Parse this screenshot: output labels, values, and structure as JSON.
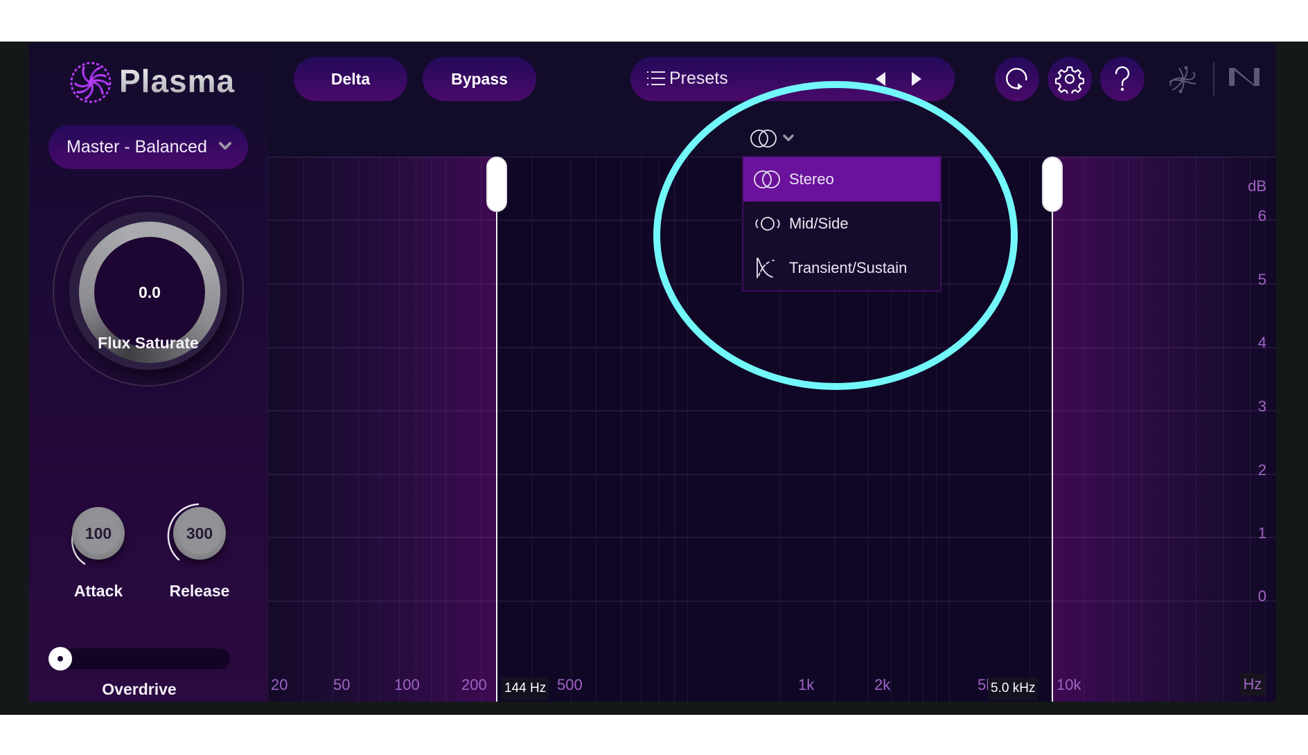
{
  "app": {
    "name": "Plasma",
    "logo_icon": "plasma-spiral-logo",
    "brand_accent": "#a436f0",
    "background": "#120b2a"
  },
  "sidebar": {
    "preset_select": {
      "value": "Master - Balanced",
      "icon": "chevron-down-icon"
    },
    "main_knob": {
      "label": "Flux Saturate",
      "value": "0.0"
    },
    "attack_knob": {
      "label": "Attack",
      "value": "100"
    },
    "release_knob": {
      "label": "Release",
      "value": "300"
    },
    "overdrive": {
      "label": "Overdrive",
      "value_fraction": 0.0
    }
  },
  "header": {
    "delta_label": "Delta",
    "bypass_label": "Bypass",
    "presets": {
      "label": "Presets",
      "list_icon": "list-icon",
      "prev_icon": "triangle-left-icon",
      "next_icon": "triangle-right-icon"
    },
    "icons": [
      {
        "name": "undo-redo-loop-icon"
      },
      {
        "name": "gear-icon"
      },
      {
        "name": "help-icon"
      }
    ],
    "vendor_logos": [
      "ozone-atom-logo",
      "native-instruments-logo"
    ]
  },
  "mode_selector": {
    "current_icon": "stereo-circles-icon",
    "options": [
      {
        "label": "Stereo",
        "icon": "stereo-circles-icon",
        "selected": true
      },
      {
        "label": "Mid/Side",
        "icon": "mid-side-icon",
        "selected": false
      },
      {
        "label": "Transient/Sustain",
        "icon": "transient-sustain-icon",
        "selected": false
      }
    ],
    "selected_color": "#6a129c"
  },
  "graph": {
    "x_unit": "Hz",
    "y_unit": "dB",
    "x_ticks": [
      "20",
      "50",
      "100",
      "200",
      "500",
      "1k",
      "2k",
      "5k",
      "10k"
    ],
    "y_ticks": [
      "6",
      "5",
      "4",
      "3",
      "2",
      "1",
      "0"
    ],
    "crossovers": [
      {
        "readout": "144 Hz",
        "frequency_hz": 144
      },
      {
        "readout": "5.0 kHz",
        "frequency_hz": 5000
      }
    ],
    "label_color": "#a064c4"
  },
  "annotation": {
    "shape": "ellipse",
    "color": "#72f8fa",
    "target": "mode-selector-dropdown"
  }
}
